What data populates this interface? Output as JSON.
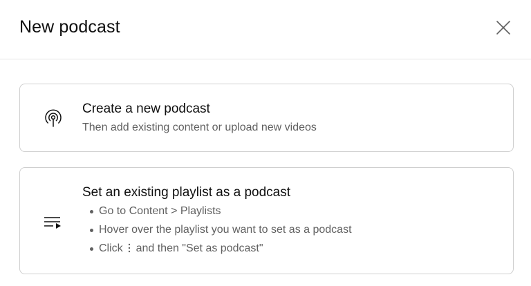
{
  "dialog": {
    "title": "New podcast",
    "close_icon": "close-icon"
  },
  "options": [
    {
      "icon": "podcast-icon",
      "title": "Create a new podcast",
      "subtitle": "Then add existing content or upload new videos"
    },
    {
      "icon": "playlist-icon",
      "title": "Set an existing playlist as a podcast",
      "steps": {
        "step1": "Go to Content > Playlists",
        "step2": "Hover over the playlist you want to set as a podcast",
        "step3_prefix": "Click",
        "step3_icon": "more-vert-icon",
        "step3_suffix": "and then \"Set as podcast\""
      }
    }
  ],
  "colors": {
    "text_primary": "#0f0f0f",
    "text_secondary": "#606060",
    "border": "#cfcfcf",
    "divider": "#e5e5e5"
  }
}
